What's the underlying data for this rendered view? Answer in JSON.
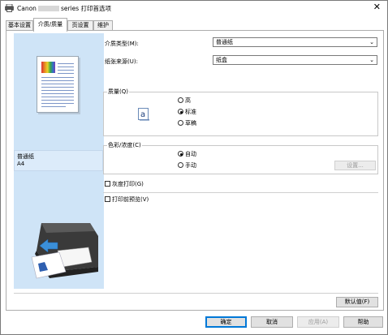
{
  "window": {
    "title_prefix": "Canon",
    "title_suffix": "series 打印首选项",
    "close_glyph": "✕"
  },
  "tabs": [
    {
      "label": "基本设置",
      "active": false
    },
    {
      "label": "介质/质量",
      "active": true
    },
    {
      "label": "页设置",
      "active": false
    },
    {
      "label": "维护",
      "active": false
    }
  ],
  "preview": {
    "media_name": "普通纸",
    "paper_size": "A4"
  },
  "settings": {
    "media_type_label": "介质类型(M):",
    "media_type_value": "普通纸",
    "paper_source_label": "纸张来源(U):",
    "paper_source_value": "纸盒",
    "quality_label": "质量(Q)",
    "quality_options": [
      "高",
      "标准",
      "草稿"
    ],
    "quality_selected": "标准",
    "color_label": "色彩/浓度(C)",
    "color_options": [
      "自动",
      "手动"
    ],
    "color_selected": "自动",
    "color_settings_button": "设置...",
    "grayscale_label": "灰度打印(G)",
    "preview_before_print_label": "打印前预览(V)"
  },
  "buttons": {
    "defaults": "默认值(F)",
    "ok": "确定",
    "cancel": "取消",
    "apply": "应用(A)",
    "help": "帮助"
  },
  "colors": {
    "accent": "#0078d7",
    "preview_bg": "#cfe4f7"
  }
}
